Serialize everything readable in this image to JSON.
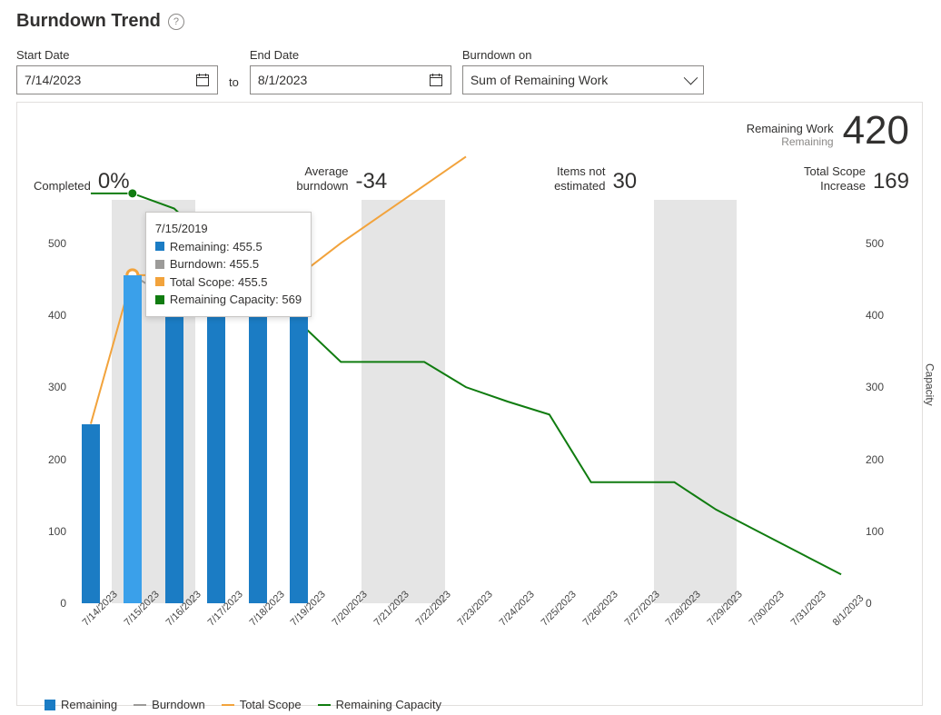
{
  "title": "Burndown Trend",
  "controls": {
    "start_date_label": "Start Date",
    "start_date_value": "7/14/2023",
    "to_label": "to",
    "end_date_label": "End Date",
    "end_date_value": "8/1/2023",
    "burndown_on_label": "Burndown on",
    "burndown_on_value": "Sum of Remaining Work"
  },
  "header_metric": {
    "label": "Remaining Work",
    "sub": "Remaining",
    "value": "420"
  },
  "stats": {
    "completed_label": "Completed",
    "completed_value": "0%",
    "avg_label_line1": "Average",
    "avg_label_line2": "burndown",
    "avg_value": "-34",
    "not_est_label_line1": "Items not",
    "not_est_label_line2": "estimated",
    "not_est_value": "30",
    "scope_label_line1": "Total Scope",
    "scope_label_line2": "Increase",
    "scope_value": "169"
  },
  "legend": {
    "remaining": "Remaining",
    "burndown": "Burndown",
    "total_scope": "Total Scope",
    "remaining_capacity": "Remaining Capacity"
  },
  "colors": {
    "remaining": "#1b7cc4",
    "remaining_highlight": "#3aa0ea",
    "burndown": "#9c9b99",
    "total_scope": "#f2a33c",
    "remaining_capacity": "#107c10",
    "band": "#e5e5e5"
  },
  "tooltip": {
    "date": "7/15/2019",
    "rows": [
      {
        "color": "#1b7cc4",
        "text": "Remaining: 455.5"
      },
      {
        "color": "#9c9b99",
        "text": "Burndown: 455.5"
      },
      {
        "color": "#f2a33c",
        "text": "Total Scope: 455.5"
      },
      {
        "color": "#107c10",
        "text": "Remaining Capacity: 569"
      }
    ]
  },
  "chart_data": {
    "type": "bar+line",
    "categories": [
      "7/14/2023",
      "7/15/2023",
      "7/16/2023",
      "7/17/2023",
      "7/18/2023",
      "7/19/2023",
      "7/20/2023",
      "7/21/2023",
      "7/22/2023",
      "7/23/2023",
      "7/24/2023",
      "7/25/2023",
      "7/26/2023",
      "7/27/2023",
      "7/28/2023",
      "7/29/2023",
      "7/30/2023",
      "7/31/2023",
      "8/1/2023"
    ],
    "weekend_bands": [
      [
        1,
        2
      ],
      [
        7,
        8
      ],
      [
        14,
        15
      ]
    ],
    "y_left": {
      "ticks": [
        0,
        100,
        200,
        300,
        400,
        500
      ],
      "max": 560
    },
    "y_right": {
      "label": "Capacity",
      "ticks": [
        0,
        100,
        200,
        300,
        400,
        500
      ],
      "max": 560
    },
    "series": [
      {
        "name": "Remaining",
        "kind": "bar",
        "color": "#1b7cc4",
        "values": [
          249,
          455.5,
          420,
          420,
          420,
          420,
          null,
          null,
          null,
          null,
          null,
          null,
          null,
          null,
          null,
          null,
          null,
          null,
          null
        ],
        "highlight_index": 1
      },
      {
        "name": "Burndown",
        "kind": "line",
        "color": "#9c9b99",
        "values": [
          null,
          455.5,
          420,
          420,
          420,
          420,
          null,
          null,
          null,
          null,
          null,
          null,
          null,
          null,
          null,
          null,
          null,
          null,
          null
        ]
      },
      {
        "name": "Total Scope",
        "kind": "line",
        "color": "#f2a33c",
        "values": [
          249,
          455.5,
          455.5,
          455.5,
          455.5,
          455.5,
          500,
          540,
          580,
          620,
          null,
          null,
          null,
          null,
          null,
          null,
          null,
          null,
          null
        ]
      },
      {
        "name": "Remaining Capacity",
        "kind": "line",
        "color": "#107c10",
        "values": [
          569,
          569,
          548,
          494,
          442,
          390,
          335,
          335,
          335,
          300,
          280,
          262,
          168,
          168,
          168,
          130,
          100,
          70,
          40
        ],
        "marker_index": 1
      }
    ]
  }
}
